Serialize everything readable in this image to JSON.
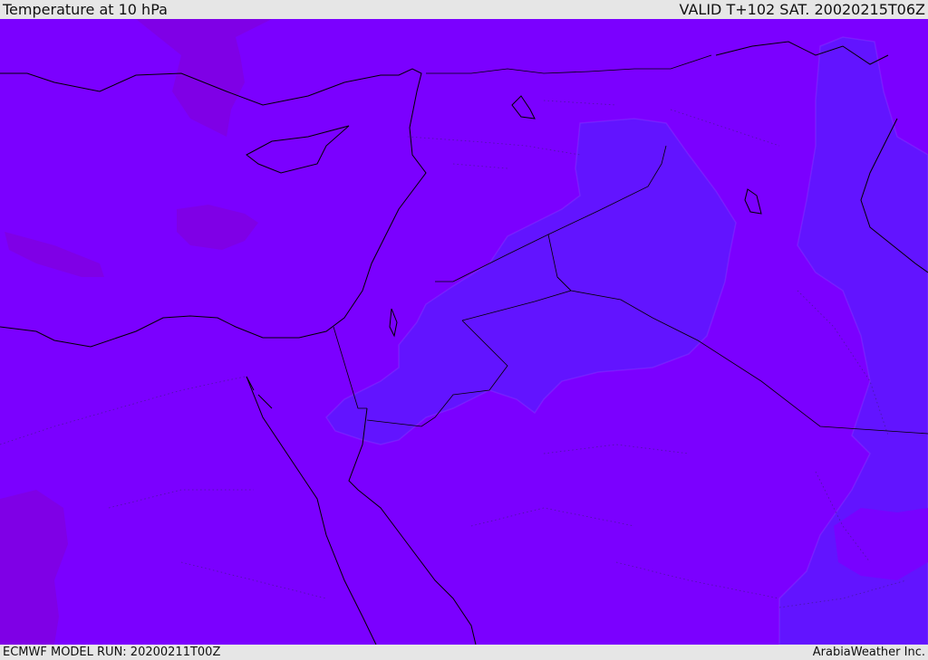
{
  "header": {
    "title": "Temperature at 10 hPa",
    "valid": "VALID T+102 SAT. 20020215T06Z"
  },
  "footer": {
    "model_run": "ECMWF MODEL RUN: 20200211T00Z",
    "credit": "ArabiaWeather Inc."
  },
  "map": {
    "colors": {
      "base": "#7b00ff",
      "cooler_band": "#6214ff",
      "warmer_patch": "#7f00e6",
      "coastline": "#000000"
    }
  }
}
